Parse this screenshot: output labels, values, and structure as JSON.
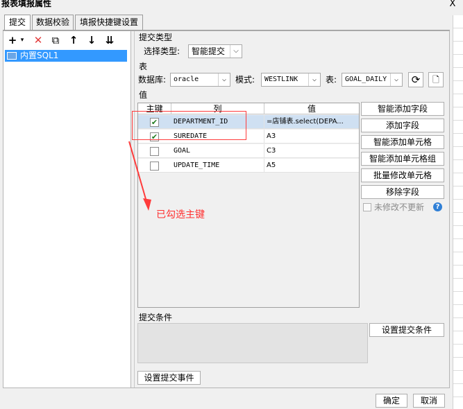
{
  "window": {
    "title": "报表填报属性",
    "close": "X"
  },
  "tabs": [
    {
      "label": "提交",
      "active": true
    },
    {
      "label": "数据校验",
      "active": false
    },
    {
      "label": "填报快捷键设置",
      "active": false
    }
  ],
  "toolbar": {
    "add": "+",
    "add_caret": "▾",
    "delete": "✕",
    "copy": "⧉",
    "up": "↑",
    "down": "↓",
    "bottom": "⇊"
  },
  "tree": {
    "item": "内置SQL1"
  },
  "submit_type": {
    "section": "提交类型",
    "label": "选择类型:",
    "value": "智能提交"
  },
  "table_section": {
    "section": "表",
    "db_label": "数据库:",
    "db_value": "oracle",
    "schema_label": "模式:",
    "schema_value": "WESTLINK",
    "table_label": "表:",
    "table_value": "GOAL_DAILY"
  },
  "value_section": {
    "section": "值",
    "headers": {
      "key": "主键",
      "column": "列",
      "value": "值"
    },
    "rows": [
      {
        "checked": true,
        "column": "DEPARTMENT_ID",
        "value": "=店铺表.select(DEPA...",
        "selected": true
      },
      {
        "checked": true,
        "column": "SUREDATE",
        "value": "A3",
        "selected": false
      },
      {
        "checked": false,
        "column": "GOAL",
        "value": "C3",
        "selected": false
      },
      {
        "checked": false,
        "column": "UPDATE_TIME",
        "value": "A5",
        "selected": false
      }
    ]
  },
  "side_buttons": {
    "smart_add_field": "智能添加字段",
    "add_field": "添加字段",
    "smart_add_cell": "智能添加单元格",
    "smart_add_cell_group": "智能添加单元格组",
    "batch_modify_cell": "批量修改单元格",
    "remove_field": "移除字段",
    "no_update_unmodified": "未修改不更新",
    "help": "?"
  },
  "annotation": {
    "text": "已勾选主键",
    "color": "#ff2f2f"
  },
  "submit_condition": {
    "section": "提交条件",
    "button": "设置提交条件"
  },
  "submit_event": {
    "button": "设置提交事件"
  },
  "footer": {
    "ok": "确定",
    "cancel": "取消"
  },
  "colors": {
    "selection": "#3399ff",
    "row_selected": "#cfe0f2",
    "checkbox_check": "#1e7b1e"
  }
}
